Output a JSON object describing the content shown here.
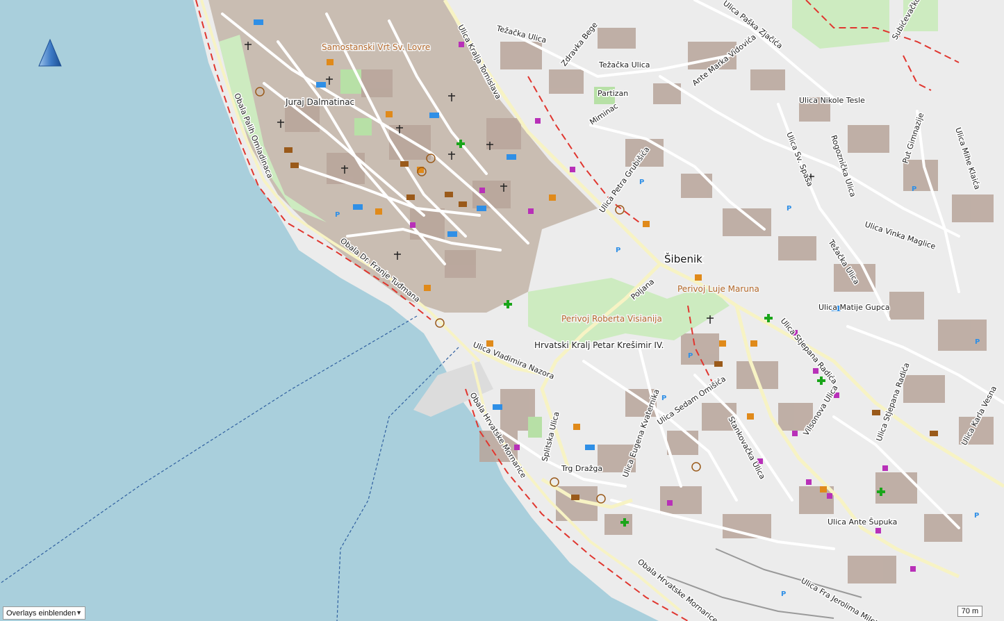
{
  "map": {
    "colors": {
      "water": "#a9cfdc",
      "land": "#ececec",
      "oldtown": "#c9bdb2",
      "building": "#b8a59a",
      "park": "#cdebc0",
      "park_dark": "#b7e0a6",
      "road": "#ffffff",
      "main_road": "#f7f3c4",
      "path_red": "#e0362f",
      "ferry": "#2f5f9f",
      "poi_brown": "#9a5a1a",
      "poi_orange": "#e08a1a",
      "poi_magenta": "#b830b8",
      "poi_blue": "#2f8fe6",
      "poi_green": "#1aa51a"
    },
    "labels": {
      "samostanski": "Samostanski Vrt Sv. Lovre",
      "juraj": "Juraj Dalmatinac",
      "obala_palih": "Obala Palih Omladinaca",
      "obala_franje": "Obala Dr. Franje Tuđmana",
      "kralja_tomislava": "Ulica Kralja Tomislava",
      "tezacka1": "Težačka Ulica",
      "tezacka2": "Težačka Ulica",
      "tezacka3": "Težačka Ulica",
      "zdravka": "Zdravka Bege",
      "partizan": "Partizan",
      "miminac": "Miminac",
      "ante_marka": "Ante Marka Vidovića",
      "paska": "Ulica Paška Zjačića",
      "subiceva": "Subićevačko",
      "nikole_tesle": "Ulica Nikole Tesle",
      "sv_spasa": "Ulica Sv. Spasa",
      "rogoznicka": "Rogoznička Ulica",
      "put_gimnazije": "Put Gimnazije",
      "mihe_klaica": "Ulica Mihe Klaića",
      "petra_grubisica": "Ulica Petra Grubišića",
      "sibenik": "Šibenik",
      "vinka_maglice": "Ulica Vinka Maglice",
      "perivoj_luje": "Perivoj Luje Maruna",
      "perivoj_roberta": "Perivoj Roberta Visianija",
      "poljana": "Poljana",
      "matije_gupca": "Ulica Matije Gupca",
      "hrvatski_kralj": "Hrvatski Kralj Petar Krešimir IV.",
      "vladimira_nazora": "Ulica Vladimira Nazora",
      "stjepana_radica1": "Ulica Stjepana Radića",
      "stjepana_radica2": "Ulica Stjepana Radića",
      "obala_hrvatske1": "Obala Hrvatske Mornarice",
      "obala_hrvatske2": "Obala Hrvatske Mornarice",
      "splitska": "Splitska Ulica",
      "trg_draga": "Trg Dražga",
      "eugena": "Ulica Eugena Kvaternika",
      "sedam_omisica": "Ulica Sedam Omišića",
      "stankovacka": "Stankovačka Ulica",
      "vilsonova": "Vilsonova Ulica",
      "ante_supuka": "Ulica Ante Šupuka",
      "karla_vesna": "Ulica Karla Vesna",
      "fra_jerolima": "Ulica Fra Jerolima Milete"
    }
  },
  "controls": {
    "overlays_label": "Overlays einblenden",
    "scale_label": "70 m"
  }
}
